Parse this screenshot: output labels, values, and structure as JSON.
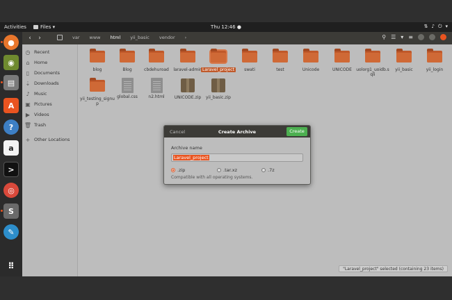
{
  "top_panel": {
    "activities": "Activities",
    "app_name": "Files ▾",
    "clock": "Thu 12:46 ●"
  },
  "headerbar": {
    "breadcrumbs": [
      "var",
      "www",
      "html",
      "yii_basic",
      "vendor"
    ]
  },
  "sidebar": {
    "items": [
      {
        "label": "Recent",
        "icon": "clock-icon"
      },
      {
        "label": "Home",
        "icon": "home-icon"
      },
      {
        "label": "Documents",
        "icon": "documents-icon"
      },
      {
        "label": "Downloads",
        "icon": "download-icon"
      },
      {
        "label": "Music",
        "icon": "music-icon"
      },
      {
        "label": "Pictures",
        "icon": "pictures-icon"
      },
      {
        "label": "Videos",
        "icon": "videos-icon"
      },
      {
        "label": "Trash",
        "icon": "trash-icon"
      },
      {
        "label": "Other Locations",
        "icon": "plus-icon"
      }
    ]
  },
  "files": [
    {
      "name": "blog",
      "type": "folder"
    },
    {
      "name": "Blog",
      "type": "folder"
    },
    {
      "name": "cbdehuroad",
      "type": "folder"
    },
    {
      "name": "laravel-admin",
      "type": "folder"
    },
    {
      "name": "Laravel_project",
      "type": "folder",
      "selected": true
    },
    {
      "name": "swati",
      "type": "folder"
    },
    {
      "name": "test",
      "type": "folder"
    },
    {
      "name": "Unicode",
      "type": "folder"
    },
    {
      "name": "UNICODE",
      "type": "folder"
    },
    {
      "name": "uolorg1_uoidb.sqli",
      "type": "folder"
    },
    {
      "name": "yii_basic",
      "type": "folder"
    },
    {
      "name": "yii_login",
      "type": "folder"
    },
    {
      "name": "yii_testing_signup",
      "type": "folder"
    },
    {
      "name": "global.css",
      "type": "doc"
    },
    {
      "name": "n2.html",
      "type": "doc"
    },
    {
      "name": "UNICODE.zip",
      "type": "archive"
    },
    {
      "name": "yii_basic.zip",
      "type": "archive"
    }
  ],
  "statusbar": {
    "text": "\"Laravel_project\" selected (containing 23 items)"
  },
  "dialog": {
    "cancel": "Cancel",
    "title": "Create Archive",
    "create": "Create",
    "name_label": "Archive name",
    "name_value": "Laravel_project",
    "formats": [
      {
        "label": ".zip",
        "selected": true
      },
      {
        "label": ".tar.xz",
        "selected": false
      },
      {
        "label": ".7z",
        "selected": false
      }
    ],
    "hint": "Compatible with all operating systems."
  },
  "colors": {
    "accent": "#e95420",
    "create_button": "#4caf50",
    "folder": "#cf6936"
  }
}
